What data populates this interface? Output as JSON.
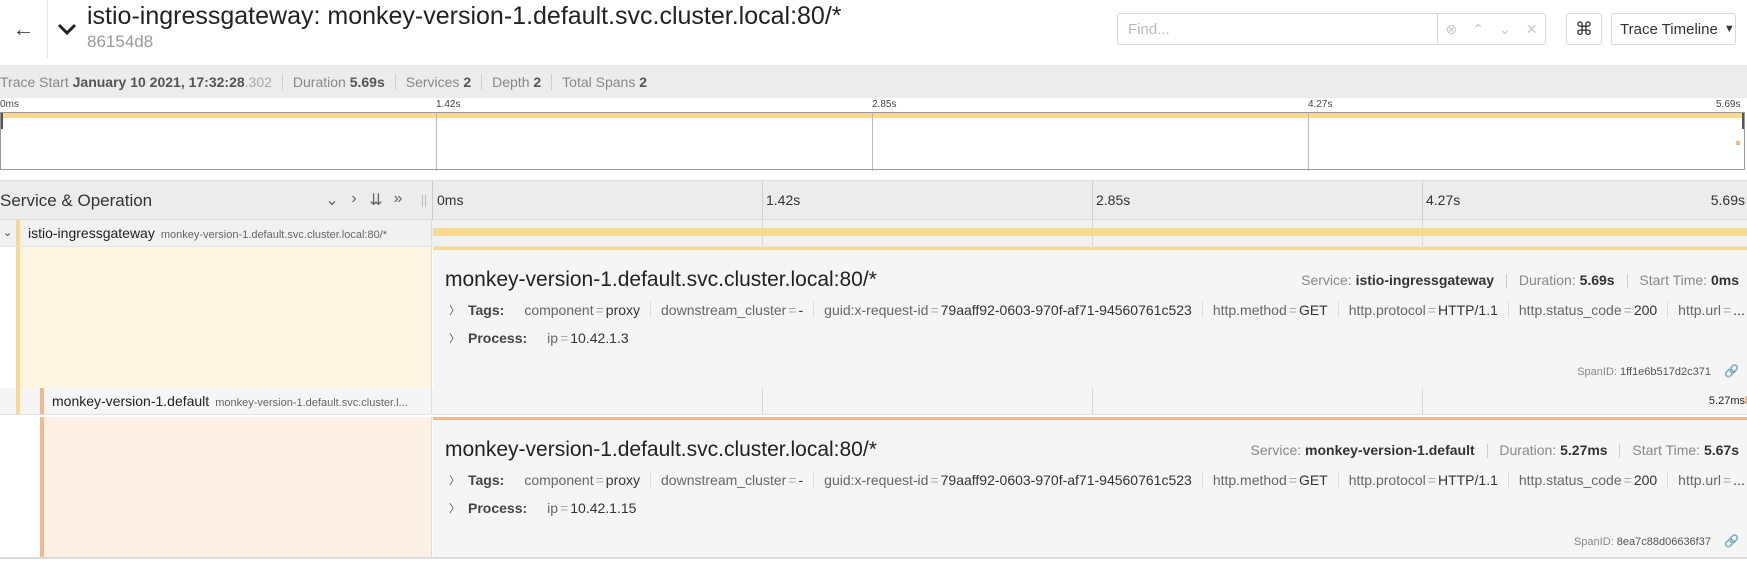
{
  "header": {
    "title": "istio-ingressgateway: monkey-version-1.default.svc.cluster.local:80/*",
    "trace_id": "86154d8",
    "find_placeholder": "Find...",
    "view_selector": "Trace Timeline"
  },
  "summary": {
    "start_label": "Trace Start",
    "start_value": "January 10 2021, 17:32:28",
    "start_ms": ".302",
    "duration_label": "Duration",
    "duration_value": "5.69s",
    "services_label": "Services",
    "services_value": "2",
    "depth_label": "Depth",
    "depth_value": "2",
    "spans_label": "Total Spans",
    "spans_value": "2"
  },
  "minimap": {
    "ticks": [
      "0ms",
      "1.42s",
      "2.85s",
      "4.27s",
      "5.69s"
    ]
  },
  "timeline_header": {
    "title": "Service & Operation",
    "ticks": [
      "0ms",
      "1.42s",
      "2.85s",
      "4.27s",
      "5.69s"
    ]
  },
  "colors": {
    "gateway": "#f7d98f",
    "monkey": "#f4b88f"
  },
  "spans": [
    {
      "service": "istio-ingressgateway",
      "operation": "monkey-version-1.default.svc.cluster.local:80/*",
      "detail_title": "monkey-version-1.default.svc.cluster.local:80/*",
      "service_label": "Service:",
      "service_value": "istio-ingressgateway",
      "duration_label": "Duration:",
      "duration_value": "5.69s",
      "start_label": "Start Time:",
      "start_value": "0ms",
      "tags_label": "Tags:",
      "tags": [
        {
          "k": "component",
          "v": "proxy"
        },
        {
          "k": "downstream_cluster",
          "v": "-"
        },
        {
          "k": "guid:x-request-id",
          "v": "79aaff92-0603-970f-af71-94560761c523"
        },
        {
          "k": "http.method",
          "v": "GET"
        },
        {
          "k": "http.protocol",
          "v": "HTTP/1.1"
        },
        {
          "k": "http.status_code",
          "v": "200"
        },
        {
          "k": "http.url",
          "v": "..."
        }
      ],
      "process_label": "Process:",
      "process": [
        {
          "k": "ip",
          "v": "10.42.1.3"
        }
      ],
      "span_id_label": "SpanID:",
      "span_id": "1ff1e6b517d2c371"
    },
    {
      "service": "monkey-version-1.default",
      "operation": "monkey-version-1.default.svc.cluster.l...",
      "bar_label": "5.27ms",
      "detail_title": "monkey-version-1.default.svc.cluster.local:80/*",
      "service_label": "Service:",
      "service_value": "monkey-version-1.default",
      "duration_label": "Duration:",
      "duration_value": "5.27ms",
      "start_label": "Start Time:",
      "start_value": "5.67s",
      "tags_label": "Tags:",
      "tags": [
        {
          "k": "component",
          "v": "proxy"
        },
        {
          "k": "downstream_cluster",
          "v": "-"
        },
        {
          "k": "guid:x-request-id",
          "v": "79aaff92-0603-970f-af71-94560761c523"
        },
        {
          "k": "http.method",
          "v": "GET"
        },
        {
          "k": "http.protocol",
          "v": "HTTP/1.1"
        },
        {
          "k": "http.status_code",
          "v": "200"
        },
        {
          "k": "http.url",
          "v": "..."
        }
      ],
      "process_label": "Process:",
      "process": [
        {
          "k": "ip",
          "v": "10.42.1.15"
        }
      ],
      "span_id_label": "SpanID:",
      "span_id": "8ea7c88d06636f37"
    }
  ]
}
